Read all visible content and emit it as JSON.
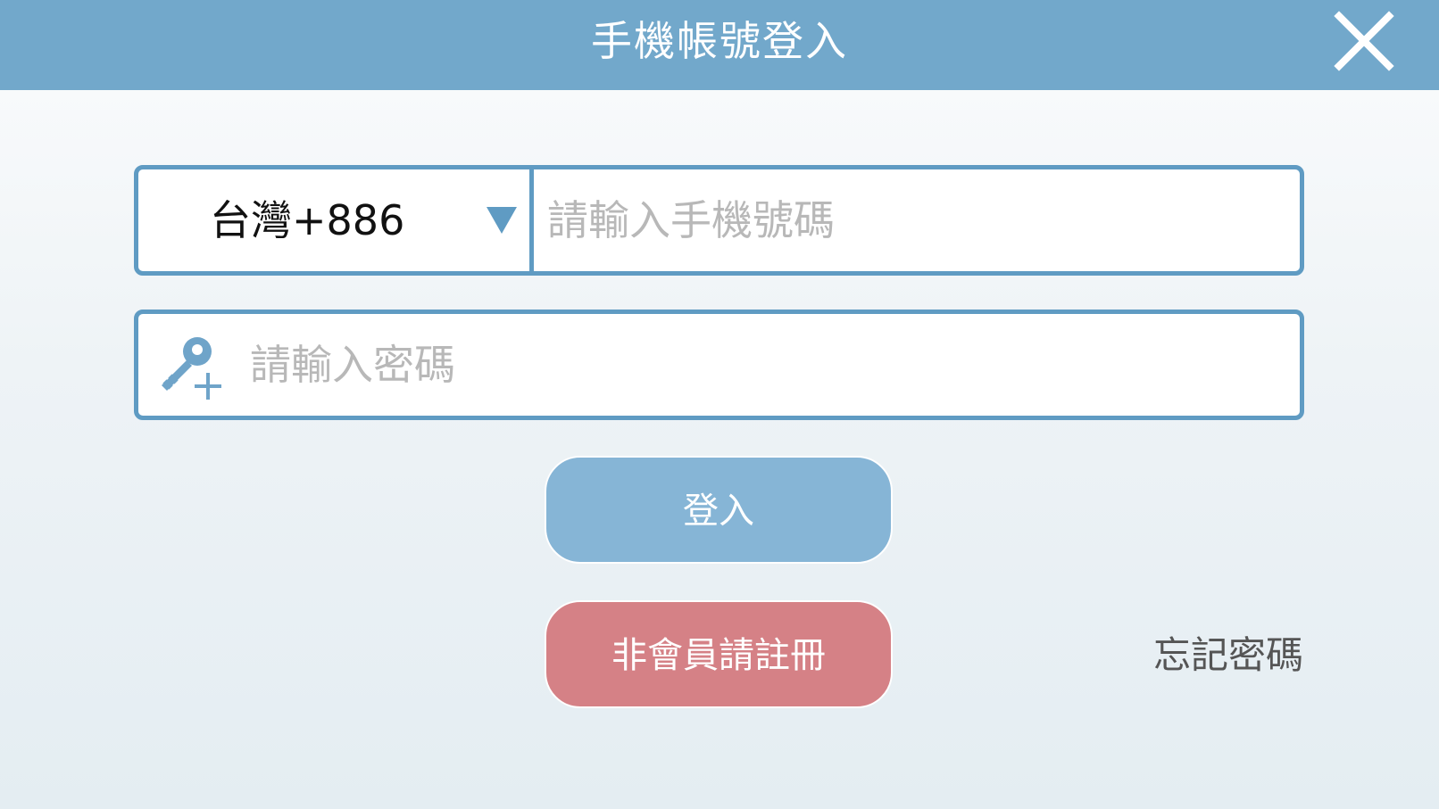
{
  "header": {
    "title": "手機帳號登入",
    "close_icon": "close-icon"
  },
  "phone": {
    "country_code_label": "台灣+886",
    "dropdown_icon": "triangle-down-icon",
    "placeholder": "請輸入手機號碼",
    "value": ""
  },
  "password": {
    "icon": "key-plus-icon",
    "placeholder": "請輸入密碼",
    "value": ""
  },
  "actions": {
    "login_label": "登入",
    "register_label": "非會員請註冊",
    "forgot_password_label": "忘記密碼"
  },
  "colors": {
    "header_bg": "#72a8cb",
    "input_border": "#5f9bc3",
    "login_button": "#86b5d6",
    "register_button": "#d58186"
  }
}
